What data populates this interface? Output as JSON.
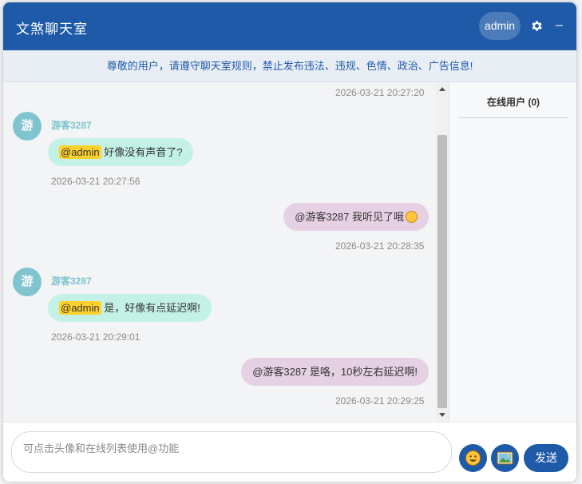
{
  "header": {
    "title": "文煞聊天室",
    "username": "admin",
    "settings_icon": "gear-icon",
    "minimize_label": "–"
  },
  "notice": {
    "text": "尊敬的用户，请遵守聊天室规则，禁止发布违法、违规、色情、政治、广告信息!"
  },
  "sidebar": {
    "online_title": "在线用户 (0)"
  },
  "messages": [
    {
      "side": "right",
      "timestamp": "2026-03-21 20:27:20"
    },
    {
      "side": "left",
      "avatar_text": "游",
      "sender": "游客3287",
      "mention": "@admin",
      "text": " 好像没有声音了?",
      "timestamp": "2026-03-21 20:27:56"
    },
    {
      "side": "right",
      "text": "@游客3287 我听见了哦",
      "emoji": "grin-emoji-icon",
      "timestamp": "2026-03-21 20:28:35"
    },
    {
      "side": "left",
      "avatar_text": "游",
      "sender": "游客3287",
      "mention": "@admin",
      "text": " 是，好像有点延迟啊!",
      "timestamp": "2026-03-21 20:29:01"
    },
    {
      "side": "right",
      "text": "@游客3287 是咯，10秒左右延迟啊!",
      "timestamp": "2026-03-21 20:29:25"
    }
  ],
  "composer": {
    "placeholder": "可点击头像和在线列表使用@功能",
    "emoji_button_icon": "emoji-icon",
    "image_button_icon": "image-icon",
    "send_label": "发送"
  },
  "colors": {
    "brand": "#1e5aa8",
    "left_bubble": "#c4f1e6",
    "right_bubble": "#e6d0e3",
    "mention": "#ffd12a",
    "sender_name": "#7fc4cf"
  }
}
